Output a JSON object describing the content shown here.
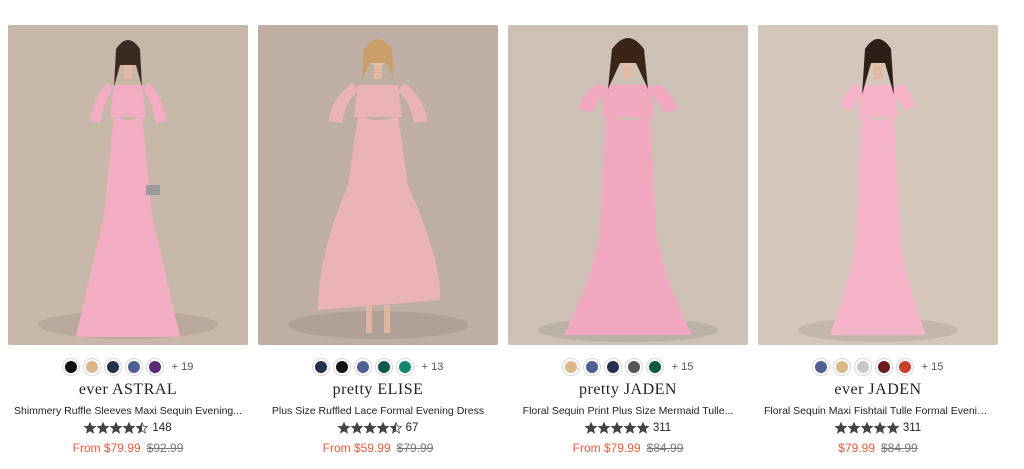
{
  "colors": {
    "accent": "#e85a3c",
    "star": "#444444"
  },
  "products": [
    {
      "brand": "ever ASTRAL",
      "name": "Shimmery Ruffle Sleeves Maxi Sequin Evening...",
      "rating_count": "148",
      "stars": 4.5,
      "price_now": "From $79.99",
      "price_was": "$92.99",
      "more_colors": "+ 19",
      "swatches": [
        "#111111",
        "#d9b98c",
        "#24304f",
        "#4e5f93",
        "#5a2a73"
      ],
      "photo": {
        "bg": "#c8b8aa",
        "dress": "#f4aec4"
      }
    },
    {
      "brand": "pretty ELISE",
      "name": "Plus Size Ruffled Lace Formal Evening Dress",
      "rating_count": "67",
      "stars": 4.5,
      "price_now": "From $59.99",
      "price_was": "$79.99",
      "more_colors": "+ 13",
      "swatches": [
        "#24304f",
        "#111111",
        "#4e5f93",
        "#0f5a4a",
        "#13866f"
      ],
      "photo": {
        "bg": "#bfaea4",
        "dress": "#e9b3b8"
      }
    },
    {
      "brand": "pretty JADEN",
      "name": "Floral Sequin Print Plus Size Mermaid Tulle...",
      "rating_count": "311",
      "stars": 5,
      "price_now": "From $79.99",
      "price_was": "$84.99",
      "more_colors": "+ 15",
      "swatches": [
        "#d9b98c",
        "#4e5f93",
        "#24304f",
        "#555555",
        "#0f5a3a"
      ],
      "photo": {
        "bg": "#cdc1b6",
        "dress": "#f2a9c0"
      }
    },
    {
      "brand": "ever JADEN",
      "name": "Floral Sequin Maxi Fishtail Tulle Formal Evening...",
      "rating_count": "311",
      "stars": 5,
      "price_now": "$79.99",
      "price_was": "$84.99",
      "more_colors": "+ 15",
      "swatches": [
        "#4e5f93",
        "#d9b98c",
        "#c8c8c8",
        "#6a1c1c",
        "#c8402a"
      ],
      "photo": {
        "bg": "#d4c6ba",
        "dress": "#f5b4c8"
      }
    }
  ]
}
